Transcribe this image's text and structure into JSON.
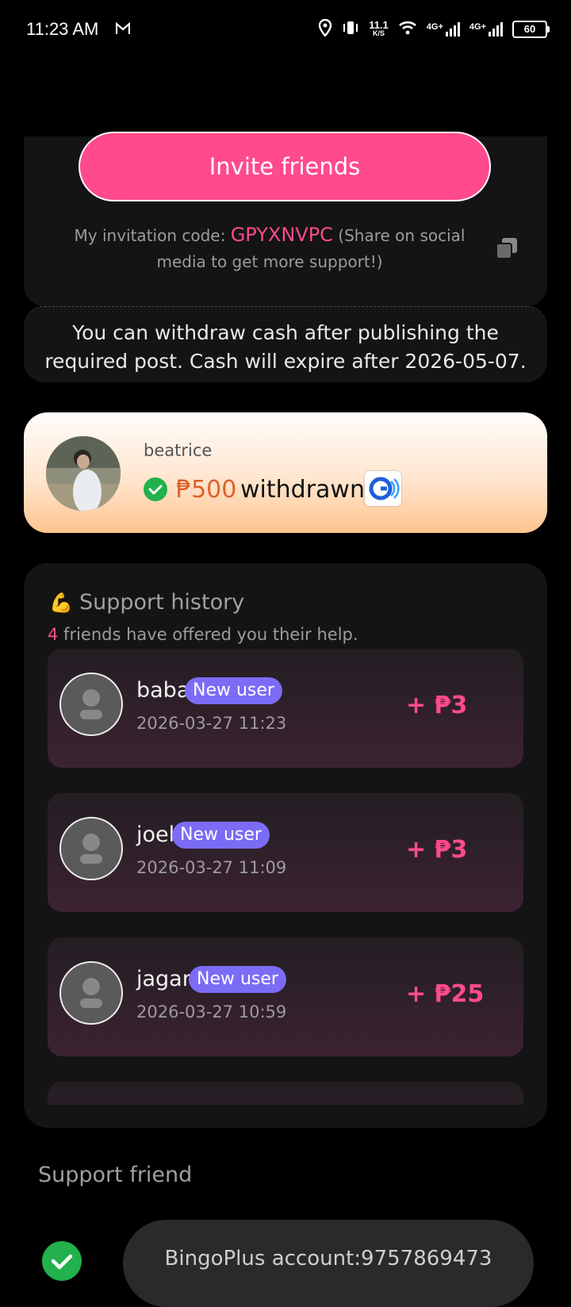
{
  "status_bar": {
    "time": "11:23 AM",
    "net_speed_value": "11.1",
    "net_speed_unit": "K/S",
    "sim1_label": "4G+",
    "sim2_label": "4G+",
    "battery": "60"
  },
  "invite": {
    "button_label": "Invite friends",
    "code_prefix": "My invitation code: ",
    "code": "GPYXNVPC",
    "code_suffix": " (Share on social media to get more support!)"
  },
  "notice": {
    "text": "You can withdraw cash after publishing the required post. Cash will expire after 2026-05-07."
  },
  "withdraw_banner": {
    "user": "beatrice",
    "amount": "₱500",
    "text": "withdrawn"
  },
  "support_history": {
    "title": "Support history",
    "count": "4",
    "subtitle": " friends have offered you their help.",
    "items": [
      {
        "name": "baba",
        "badge": "New user",
        "time": "2026-03-27 11:23",
        "amount": "+ ₱3"
      },
      {
        "name": "joel",
        "badge": "New user",
        "time": "2026-03-27 11:09",
        "amount": "+ ₱3"
      },
      {
        "name": "jagan",
        "badge": "New user",
        "time": "2026-03-27 10:59",
        "amount": "+ ₱25"
      }
    ]
  },
  "support_friend": {
    "title": "Support friend",
    "account": "BingoPlus account:9757869473"
  },
  "colors": {
    "accent_pink": "#ff4a8d",
    "badge_purple": "#7b6cf6",
    "success_green": "#22b14c",
    "amount_orange": "#e0602a"
  }
}
